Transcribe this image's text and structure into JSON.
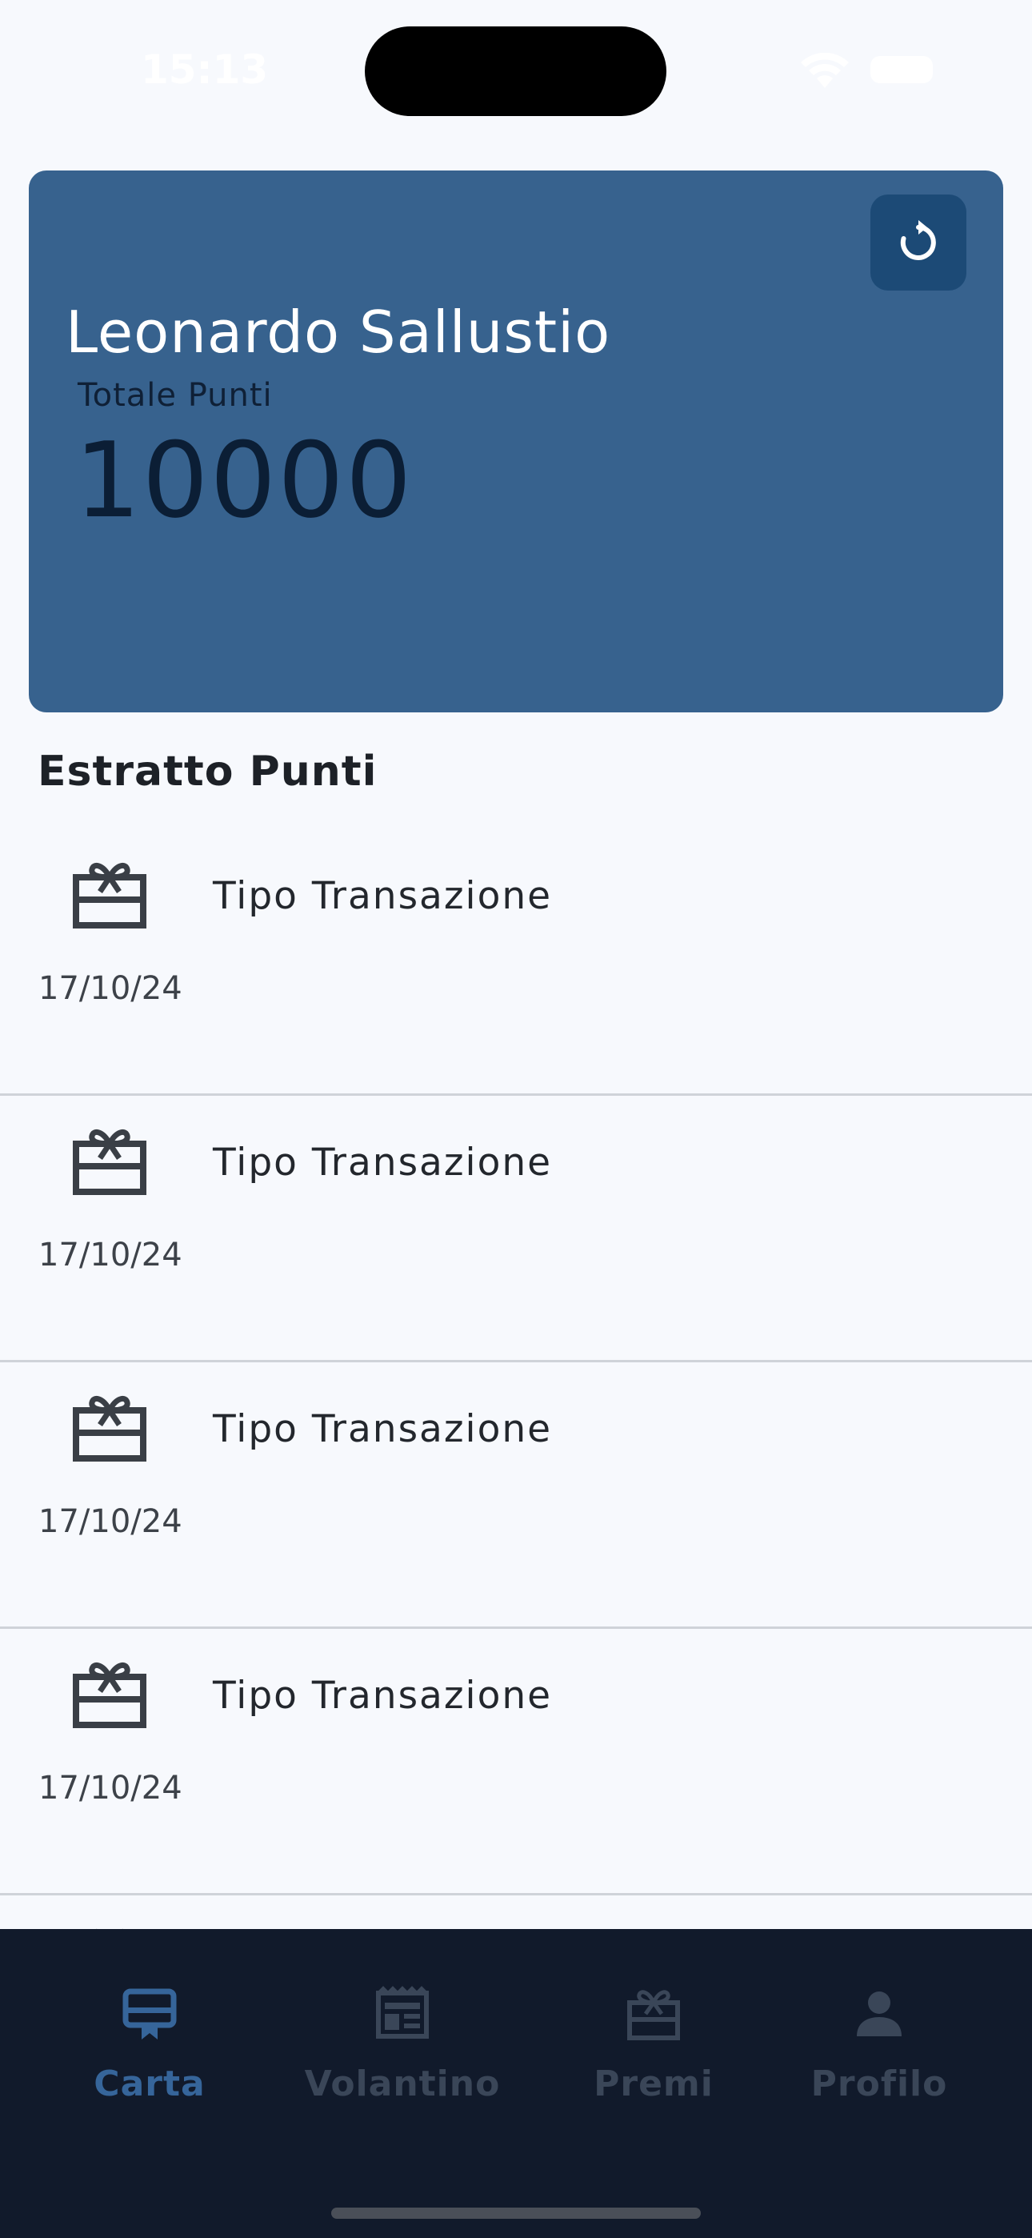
{
  "status_bar": {
    "time": "15:13"
  },
  "card": {
    "name": "Leonardo Sallustio",
    "points_label": "Totale Punti",
    "points_value": "10000",
    "background_color": "#37628e",
    "refresh_icon": "refresh-icon"
  },
  "statement": {
    "title": "Estratto Punti",
    "items": [
      {
        "icon": "gift-icon",
        "title": "Tipo Transazione",
        "date": "17/10/24"
      },
      {
        "icon": "gift-icon",
        "title": "Tipo Transazione",
        "date": "17/10/24"
      },
      {
        "icon": "gift-icon",
        "title": "Tipo Transazione",
        "date": "17/10/24"
      },
      {
        "icon": "gift-icon",
        "title": "Tipo Transazione",
        "date": "17/10/24"
      }
    ]
  },
  "bottom_nav": {
    "accent_color": "#36659a",
    "inactive_color": "#3a4658",
    "items": [
      {
        "label": "Carta",
        "icon": "card-icon",
        "active": true
      },
      {
        "label": "Volantino",
        "icon": "flyer-icon",
        "active": false
      },
      {
        "label": "Premi",
        "icon": "gift-icon",
        "active": false
      },
      {
        "label": "Profilo",
        "icon": "person-icon",
        "active": false
      }
    ]
  }
}
